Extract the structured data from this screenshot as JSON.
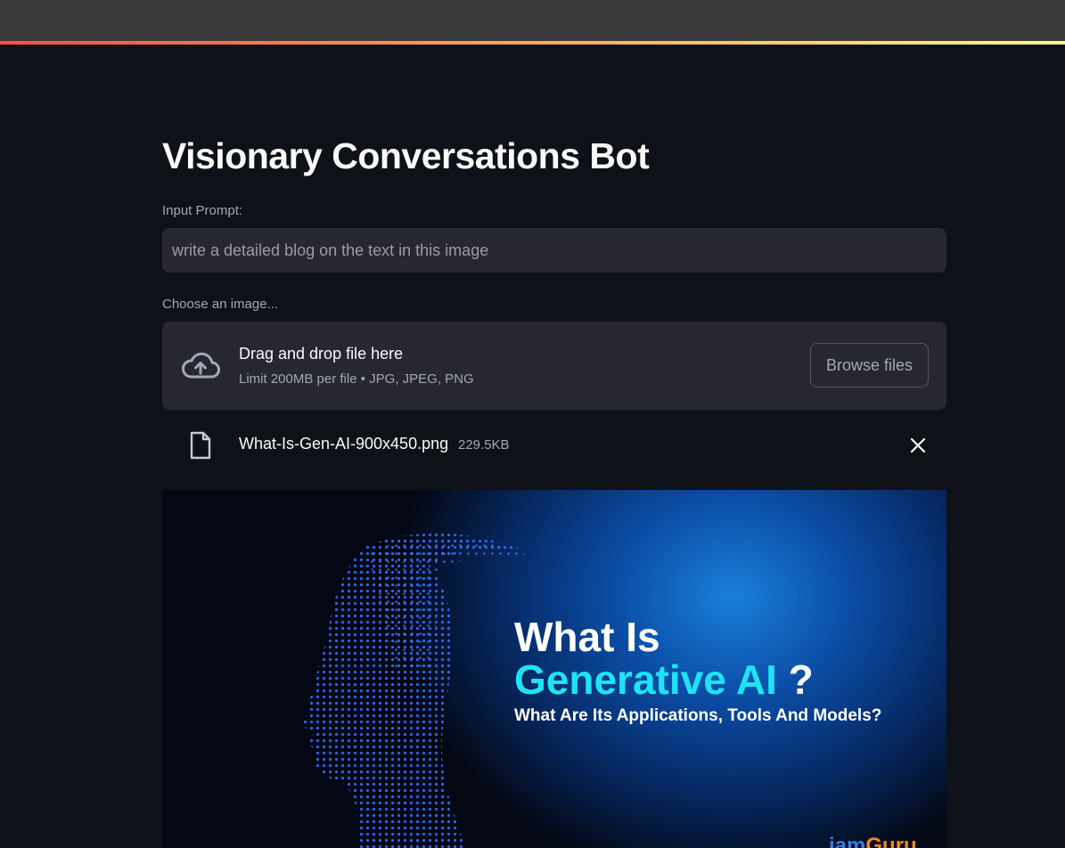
{
  "app": {
    "title": "Visionary Conversations Bot"
  },
  "prompt": {
    "label": "Input Prompt:",
    "value": "",
    "placeholder": "write a detailed blog on the text in this image"
  },
  "uploader": {
    "label": "Choose an image...",
    "drop_title": "Drag and drop file here",
    "limit_text": "Limit 200MB per file • JPG, JPEG, PNG",
    "browse_label": "Browse files",
    "icon": "cloud-upload-icon"
  },
  "uploaded_file": {
    "name": "What-Is-Gen-AI-900x450.png",
    "size": "229.5KB",
    "icon": "file-icon",
    "remove_icon": "close-icon"
  },
  "preview_image": {
    "line1": "What Is",
    "line2": "Generative AI",
    "line2_suffix": "?",
    "line3": "What Are Its Applications, Tools And Models?",
    "brand_part1": "iam",
    "brand_part2": "Guru",
    "colors": {
      "accent_cyan": "#1fe3f5",
      "glow_blue": "#1a7fd9"
    }
  },
  "theme": {
    "background": "#0e1117",
    "widget_bg": "#262730",
    "header_gradient": [
      "#ff4b4b",
      "#fffd80"
    ]
  }
}
